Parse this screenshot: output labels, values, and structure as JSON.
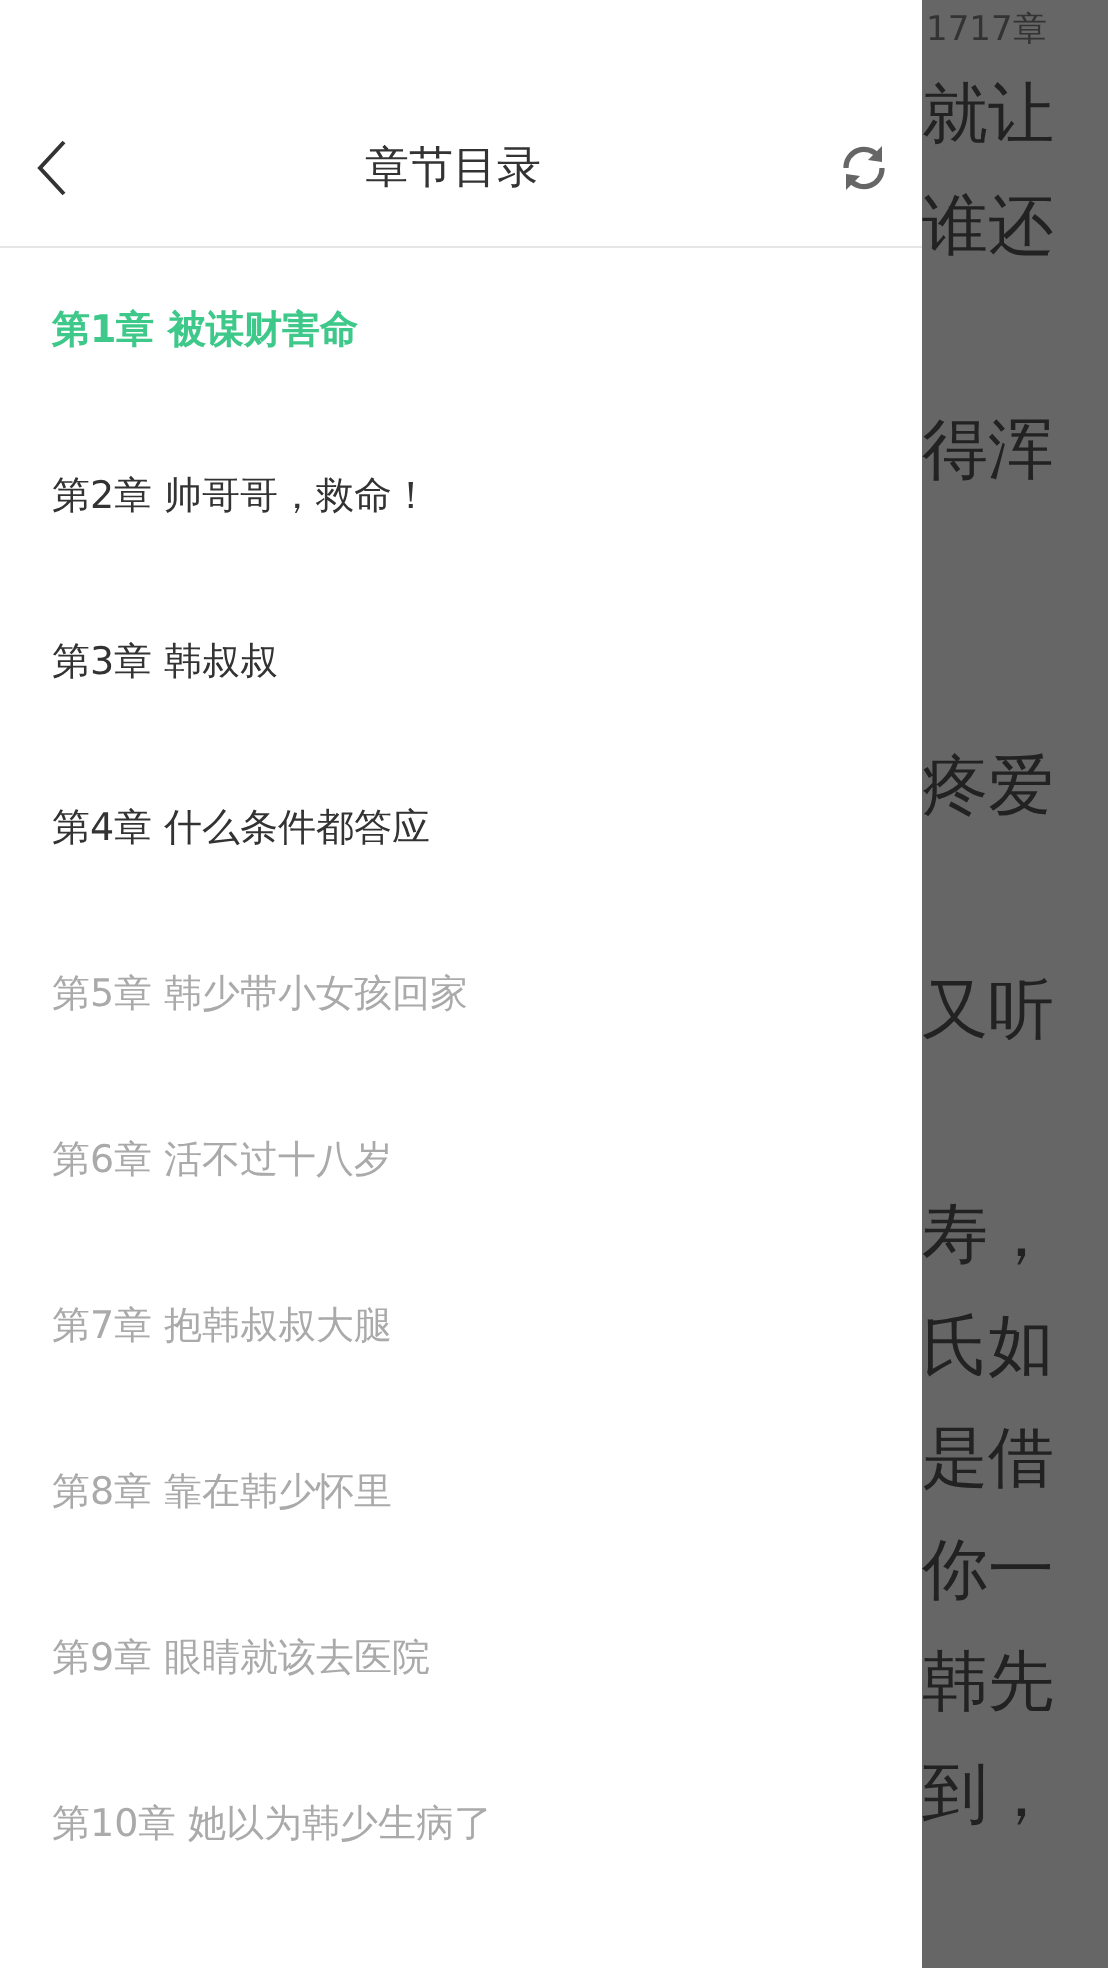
{
  "drawer": {
    "title": "章节目录",
    "chapters": [
      {
        "label": "第1章 被谋财害命",
        "selected": true
      },
      {
        "label": "第2章 帅哥哥，救命！",
        "selected": false,
        "downloaded": true
      },
      {
        "label": "第3章 韩叔叔",
        "selected": false,
        "downloaded": true
      },
      {
        "label": "第4章 什么条件都答应",
        "selected": false,
        "downloaded": true
      },
      {
        "label": "第5章 韩少带小女孩回家",
        "selected": false,
        "downloaded": false
      },
      {
        "label": "第6章 活不过十八岁",
        "selected": false,
        "downloaded": false
      },
      {
        "label": "第7章 抱韩叔叔大腿",
        "selected": false,
        "downloaded": false
      },
      {
        "label": "第8章 靠在韩少怀里",
        "selected": false,
        "downloaded": false
      },
      {
        "label": "第9章 眼睛就该去医院",
        "selected": false,
        "downloaded": false
      },
      {
        "label": "第10章 她以为韩少生病了",
        "selected": false,
        "downloaded": false
      }
    ]
  },
  "reader": {
    "chapter_label": "1717章",
    "paragraphs": [
      [
        "就让",
        "谁还"
      ],
      [
        "得浑"
      ],
      [
        "疼爱"
      ],
      [
        "又听"
      ],
      [
        "寿，",
        "氏如",
        "是借",
        "你一",
        "韩先",
        "到，"
      ]
    ]
  }
}
